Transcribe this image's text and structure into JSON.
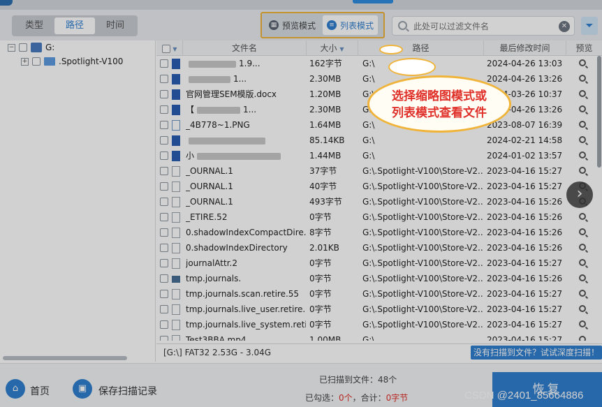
{
  "toolbar": {
    "view_tabs": [
      {
        "label": "类型",
        "active": false
      },
      {
        "label": "路径",
        "active": true
      },
      {
        "label": "时间",
        "active": false
      }
    ],
    "mode_preview_label": "预览模式",
    "mode_list_label": "列表模式",
    "search_placeholder": "此处可以过滤文件名",
    "highlight_color": "#f0b43a",
    "accent_color": "#2f7fd0"
  },
  "tree": {
    "drive_label": "G:",
    "folder_label": ".Spotlight-V100"
  },
  "grid": {
    "headers": {
      "name": "文件名",
      "size": "大小",
      "path": "路径",
      "modified": "最后修改时间",
      "preview": "预览"
    },
    "rows": [
      {
        "icon": "word",
        "name": "",
        "name_tail": "1.9...",
        "size": "162字节",
        "path": "G:\\",
        "time": "2024-04-26 13:03"
      },
      {
        "icon": "word",
        "name": "",
        "name_tail": "1...",
        "size": "2.30MB",
        "path": "G:\\",
        "time": "2024-04-26 13:26"
      },
      {
        "icon": "word",
        "name": "官网管理SEM模版.docx",
        "name_tail": "",
        "size": "1.20MB",
        "path": "G:\\",
        "time": "2024-03-26 10:37"
      },
      {
        "icon": "word",
        "name": "【",
        "name_tail": "1...",
        "size": "2.30MB",
        "path": "G:\\",
        "time": "2024-04-26 13:26"
      },
      {
        "icon": "img",
        "name": "_4B778~1.PNG",
        "name_tail": "",
        "size": "1.64MB",
        "path": "G:\\",
        "time": "2023-08-07 16:39"
      },
      {
        "icon": "word",
        "name": "",
        "name_tail": "",
        "size": "85.14KB",
        "path": "G:\\",
        "time": "2024-02-21 14:58"
      },
      {
        "icon": "word",
        "name": "小",
        "name_tail": "",
        "size": "1.44MB",
        "path": "G:\\",
        "time": "2024-01-02 13:57"
      },
      {
        "icon": "file",
        "name": "_OURNAL.1",
        "name_tail": "",
        "size": "37字节",
        "path": "G:\\.Spotlight-V100\\Store-V2...",
        "time": "2023-04-16 15:27"
      },
      {
        "icon": "file",
        "name": "_OURNAL.1",
        "name_tail": "",
        "size": "40字节",
        "path": "G:\\.Spotlight-V100\\Store-V2...",
        "time": "2023-04-16 15:27"
      },
      {
        "icon": "file",
        "name": "_OURNAL.1",
        "name_tail": "",
        "size": "493字节",
        "path": "G:\\.Spotlight-V100\\Store-V2...",
        "time": "2023-04-16 15:26"
      },
      {
        "icon": "file",
        "name": "_ETIRE.52",
        "name_tail": "",
        "size": "0字节",
        "path": "G:\\.Spotlight-V100\\Store-V2...",
        "time": "2023-04-16 15:26"
      },
      {
        "icon": "file",
        "name": "0.shadowIndexCompactDire...",
        "name_tail": "",
        "size": "8字节",
        "path": "G:\\.Spotlight-V100\\Store-V2...",
        "time": "2023-04-16 15:26"
      },
      {
        "icon": "file",
        "name": "0.shadowIndexDirectory",
        "name_tail": "",
        "size": "2.01KB",
        "path": "G:\\.Spotlight-V100\\Store-V2...",
        "time": "2023-04-16 15:26"
      },
      {
        "icon": "file",
        "name": "journalAttr.2",
        "name_tail": "",
        "size": "0字节",
        "path": "G:\\.Spotlight-V100\\Store-V2...",
        "time": "2023-04-16 15:27"
      },
      {
        "icon": "tmp",
        "name": "tmp.journals.",
        "name_tail": "",
        "size": "0字节",
        "path": "G:\\.Spotlight-V100\\Store-V2...",
        "time": "2023-04-16 15:26"
      },
      {
        "icon": "file",
        "name": "tmp.journals.scan.retire.55",
        "name_tail": "",
        "size": "0字节",
        "path": "G:\\.Spotlight-V100\\Store-V2...",
        "time": "2023-04-16 15:27"
      },
      {
        "icon": "file",
        "name": "tmp.journals.live_user.retire.2",
        "name_tail": "",
        "size": "0字节",
        "path": "G:\\.Spotlight-V100\\Store-V2...",
        "time": "2023-04-16 15:27"
      },
      {
        "icon": "file",
        "name": "tmp.journals.live_system.reti...",
        "name_tail": "",
        "size": "0字节",
        "path": "G:\\.Spotlight-V100\\Store-V2...",
        "time": "2023-04-16 15:27"
      },
      {
        "icon": "file",
        "name": "Test3BBA.mp4",
        "name_tail": "",
        "size": "1.00MB",
        "path": "G:\\",
        "time": "2023-04-16 15:27"
      }
    ]
  },
  "status": {
    "drive_info": "[G:\\] FAT32 2.53G - 3.04G",
    "deep_scan": "没有扫描到文件？试试深度扫描！"
  },
  "footer": {
    "home_label": "首页",
    "save_label": "保存扫描记录",
    "scanned_prefix": "已扫描到文件：",
    "scanned_count": "48个",
    "selected_prefix": "已勾选：",
    "selected_count": "0个",
    "total_prefix": "，合计：",
    "total_size": "0字节",
    "restore_label": "恢复",
    "watermark": "CSDN @2401_85664886"
  },
  "annotation": {
    "line1": "选择缩略图模式或",
    "line2": "列表模式查看文件"
  }
}
